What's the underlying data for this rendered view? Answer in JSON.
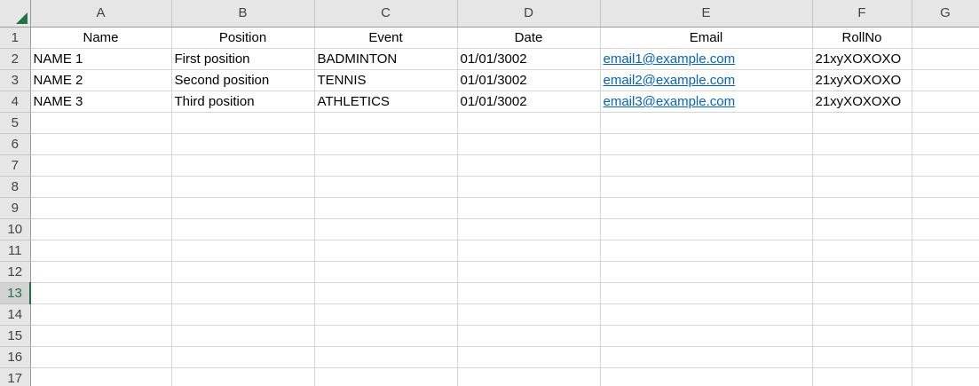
{
  "columns": [
    "A",
    "B",
    "C",
    "D",
    "E",
    "F",
    "G"
  ],
  "row_numbers": [
    "1",
    "2",
    "3",
    "4",
    "5",
    "6",
    "7",
    "8",
    "9",
    "10",
    "11",
    "12",
    "13",
    "14",
    "15",
    "16",
    "17"
  ],
  "active_row": "13",
  "header_row": {
    "name": "Name",
    "position": "Position",
    "event": "Event",
    "date": "Date",
    "email": "Email",
    "rollno": "RollNo"
  },
  "rows": [
    {
      "name": "NAME 1",
      "position": "First position",
      "event": "BADMINTON",
      "date": "01/01/3002",
      "email": "email1@example.com",
      "rollno": "21xyXOXOXO"
    },
    {
      "name": "NAME 2",
      "position": "Second position",
      "event": "TENNIS",
      "date": "01/01/3002",
      "email": "email2@example.com",
      "rollno": "21xyXOXOXO"
    },
    {
      "name": "NAME 3",
      "position": "Third position",
      "event": "ATHLETICS",
      "date": "01/01/3002",
      "email": "email3@example.com",
      "rollno": "21xyXOXOXO"
    }
  ],
  "colors": {
    "accent": "#217346",
    "link": "#0563c1",
    "header_bg": "#e6e6e6"
  }
}
